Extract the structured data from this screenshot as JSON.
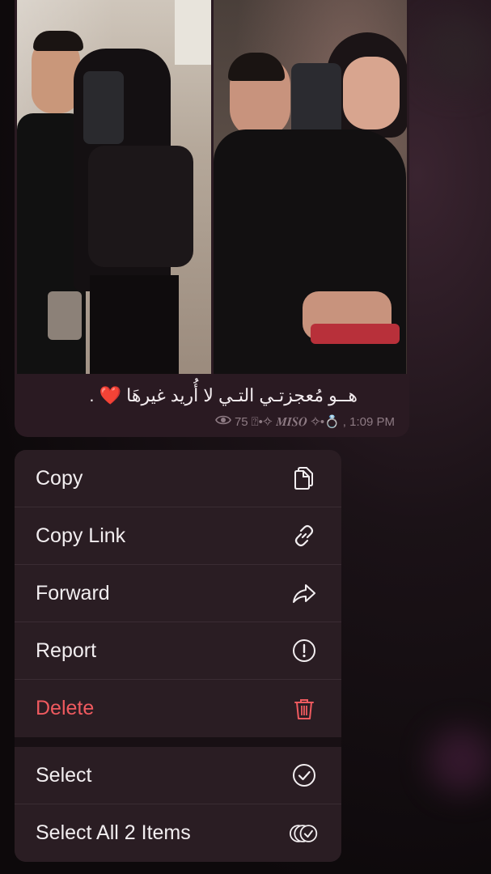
{
  "message": {
    "caption": "هــو مُعجزتـي التـي لا أُريد غيرهَا",
    "caption_punct": ".",
    "views": "75",
    "author_tag": "⍰•✧ 𝑴𝑰𝑺𝑶 ✧•💍",
    "time": ", 1:09 PM"
  },
  "menu": {
    "items": [
      {
        "label": "Copy",
        "icon": "copy-icon"
      },
      {
        "label": "Copy Link",
        "icon": "link-icon"
      },
      {
        "label": "Forward",
        "icon": "forward-icon"
      },
      {
        "label": "Report",
        "icon": "report-icon"
      },
      {
        "label": "Delete",
        "icon": "trash-icon",
        "color": "#ef5a5f"
      }
    ],
    "select_items": [
      {
        "label": "Select",
        "icon": "check-circle-icon"
      },
      {
        "label": "Select All 2 Items",
        "icon": "select-all-icon"
      }
    ]
  }
}
